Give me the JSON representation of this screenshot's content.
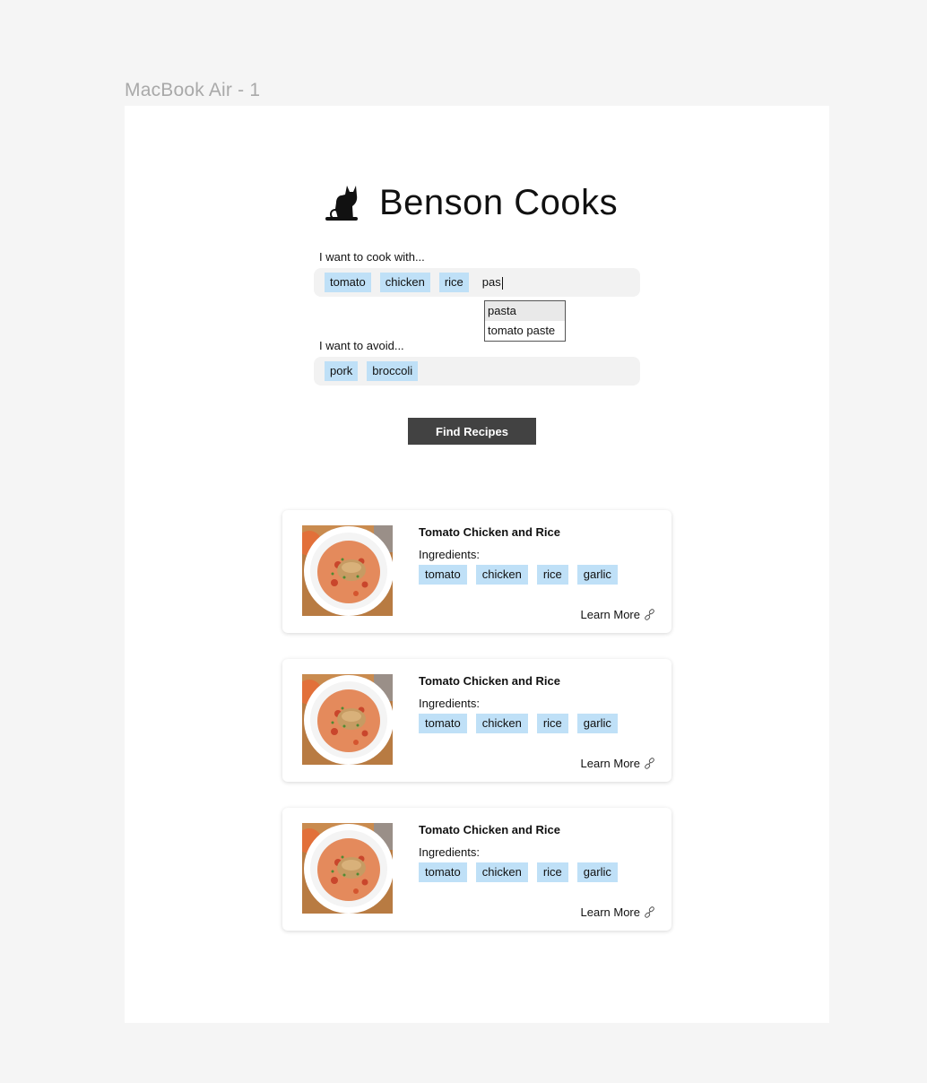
{
  "frame": {
    "label": "MacBook Air - 1"
  },
  "app": {
    "title": "Benson Cooks",
    "logo_icon": "cat-icon"
  },
  "include": {
    "label": "I want to cook with...",
    "chips": [
      "tomato",
      "chicken",
      "rice"
    ],
    "typed_value": "pas",
    "suggestions": [
      "pasta",
      "tomato paste"
    ]
  },
  "exclude": {
    "label": "I want to avoid...",
    "chips": [
      "pork",
      "broccoli"
    ]
  },
  "find_button": {
    "label": "Find Recipes"
  },
  "results": [
    {
      "title": "Tomato Chicken and Rice",
      "ingredients_label": "Ingredients:",
      "ingredients": [
        "tomato",
        "chicken",
        "rice",
        "garlic"
      ],
      "link_label": "Learn More",
      "link_icon": "link-icon"
    },
    {
      "title": "Tomato Chicken and Rice",
      "ingredients_label": "Ingredients:",
      "ingredients": [
        "tomato",
        "chicken",
        "rice",
        "garlic"
      ],
      "link_label": "Learn More",
      "link_icon": "link-icon"
    },
    {
      "title": "Tomato Chicken and Rice",
      "ingredients_label": "Ingredients:",
      "ingredients": [
        "tomato",
        "chicken",
        "rice",
        "garlic"
      ],
      "link_label": "Learn More",
      "link_icon": "link-icon"
    }
  ],
  "colors": {
    "chip": "#bfe0f7",
    "button": "#424242",
    "field": "#f2f2f2",
    "canvas": "#f5f5f5"
  }
}
